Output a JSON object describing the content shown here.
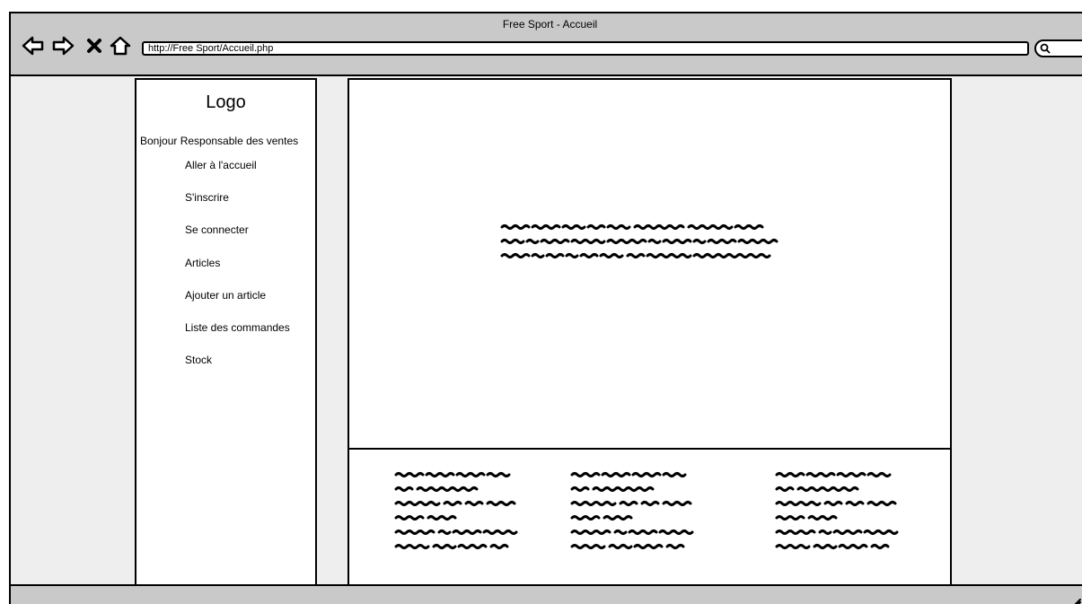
{
  "window": {
    "title": "Free Sport - Accueil"
  },
  "address_bar": {
    "url": "http://Free Sport/Accueil.php"
  },
  "toolbar": {
    "icons": [
      "back-arrow-icon",
      "forward-arrow-icon",
      "close-x-icon",
      "home-icon",
      "search-icon"
    ]
  },
  "sidebar": {
    "logo": "Logo",
    "greeting": "Bonjour Responsable des ventes",
    "items": [
      {
        "label": "Aller à l'accueil"
      },
      {
        "label": "S'inscrire"
      },
      {
        "label": "Se connecter"
      },
      {
        "label": "Articles"
      },
      {
        "label": "Ajouter un article"
      },
      {
        "label": "Liste des commandes"
      },
      {
        "label": "Stock"
      }
    ]
  },
  "colors": {
    "chrome": "#c9c9c9",
    "background": "#eeeeee",
    "panel": "#ffffff",
    "outline": "#000000"
  }
}
